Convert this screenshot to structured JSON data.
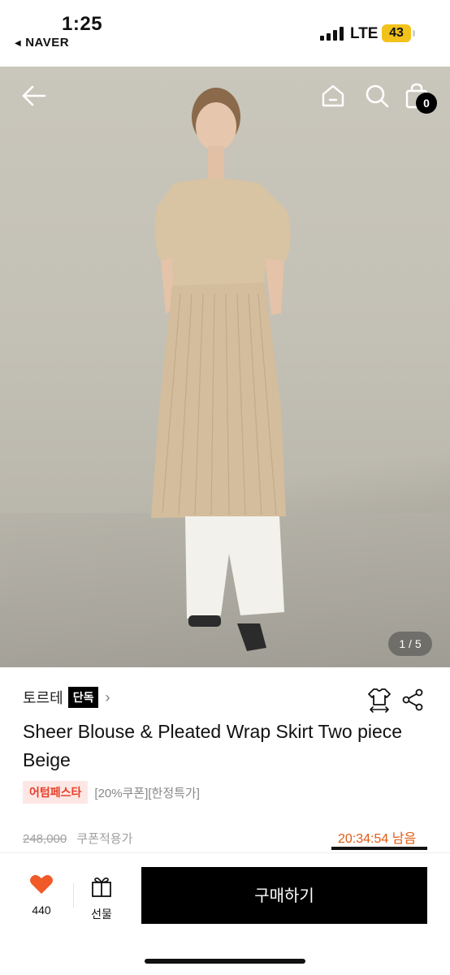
{
  "status_bar": {
    "time": "1:25",
    "back_app": "NAVER",
    "network": "LTE",
    "battery": "43"
  },
  "header": {
    "cart_count": "0",
    "icons": [
      "back-arrow-icon",
      "home-icon",
      "search-icon",
      "shopping-bag-icon"
    ]
  },
  "gallery": {
    "counter": "1 / 5"
  },
  "product": {
    "brand": "토르테",
    "exclusive_badge": "단독",
    "title": "Sheer Blouse & Pleated Wrap Skirt Two piece Beige",
    "promo_tag": "어텀페스타",
    "coupon_text": "[20%쿠폰][한정특가]",
    "original_price": "248,000",
    "coupon_price_label": "쿠폰적용가",
    "countdown": "20:34:54 남음"
  },
  "bottom_bar": {
    "like_count": "440",
    "gift_label": "선물",
    "buy_label": "구매하기"
  },
  "colors": {
    "accent_orange": "#e05a12",
    "promo_red": "#e8402a",
    "heart": "#f05a28",
    "battery": "#f2c21b"
  }
}
